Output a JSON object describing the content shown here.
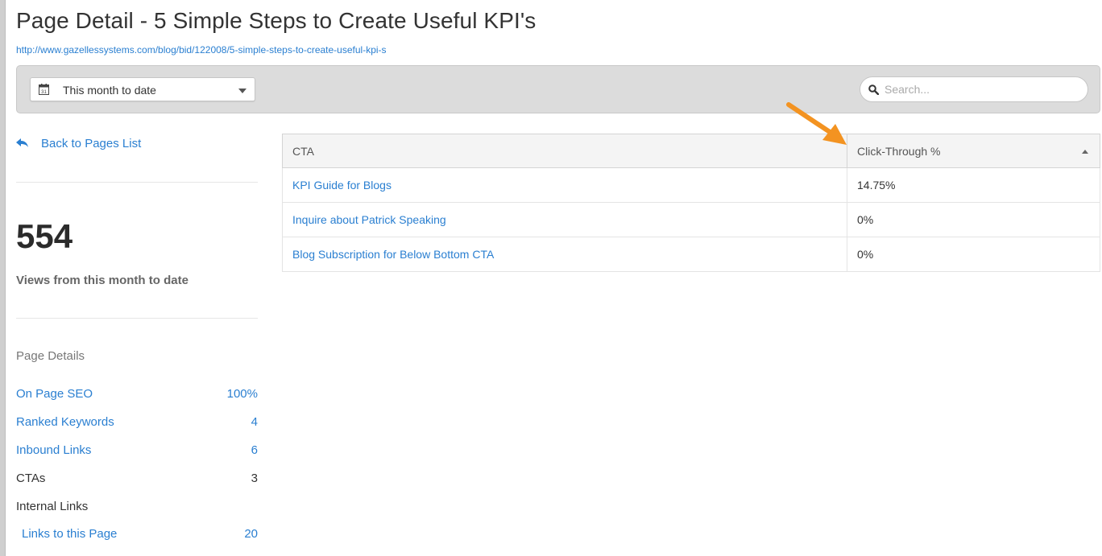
{
  "page": {
    "title": "Page Detail - 5 Simple Steps to Create Useful KPI's",
    "url": "http://www.gazellessystems.com/blog/bid/122008/5-simple-steps-to-create-useful-kpi-s"
  },
  "toolbar": {
    "date_range": "This month to date",
    "date_icon": "calendar-icon",
    "search_placeholder": "Search..."
  },
  "sidebar": {
    "back_label": "Back to Pages List",
    "views_count": "554",
    "views_label": "Views from this month to date",
    "details_heading": "Page Details",
    "stats": [
      {
        "label": "On Page SEO",
        "value": "100%"
      },
      {
        "label": "Ranked Keywords",
        "value": "4"
      },
      {
        "label": "Inbound Links",
        "value": "6"
      },
      {
        "label": "CTAs",
        "value": "3"
      },
      {
        "label": "Internal Links",
        "value": ""
      },
      {
        "label": "Links to this Page",
        "value": "20"
      }
    ]
  },
  "table": {
    "columns": [
      "CTA",
      "Click-Through %"
    ],
    "rows": [
      {
        "cta": "KPI Guide for Blogs",
        "ctr": "14.75%"
      },
      {
        "cta": "Inquire about Patrick Speaking",
        "ctr": "0%"
      },
      {
        "cta": "Blog Subscription for Below Bottom CTA",
        "ctr": "0%"
      }
    ]
  },
  "colors": {
    "link": "#2a7fd1",
    "annotation_arrow": "#f39321",
    "toolbar_bg": "#dcdcdc"
  }
}
